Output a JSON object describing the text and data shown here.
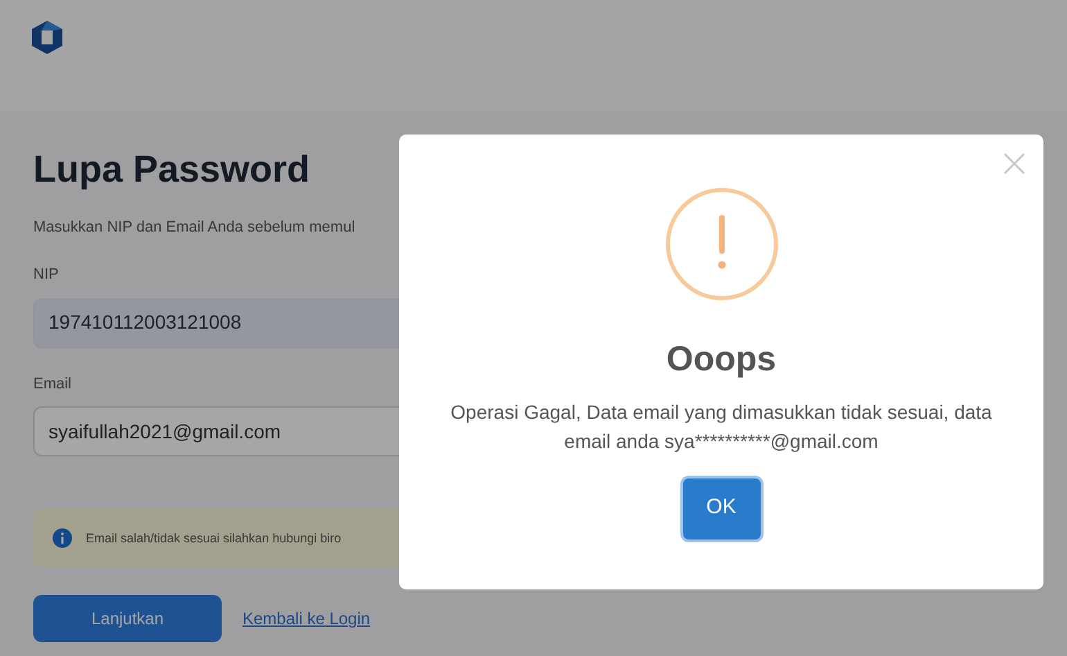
{
  "page": {
    "title": "Lupa Password",
    "description": "Masukkan NIP dan Email Anda sebelum memul",
    "fields": [
      {
        "label": "NIP",
        "value": "197410112003121008",
        "kind": "filled"
      },
      {
        "label": "Email",
        "value": "syaifullah2021@gmail.com",
        "kind": "outlined"
      }
    ],
    "notice": "Email salah/tidak sesuai silahkan hubungi biro",
    "submit": "Lanjutkan",
    "link": "Kembali ke Login"
  },
  "dialog": {
    "title": "Ooops",
    "message": "Operasi Gagal, Data email yang dimasukkan tidak sesuai, data email anda sya**********@gmail.com",
    "button": "OK"
  }
}
